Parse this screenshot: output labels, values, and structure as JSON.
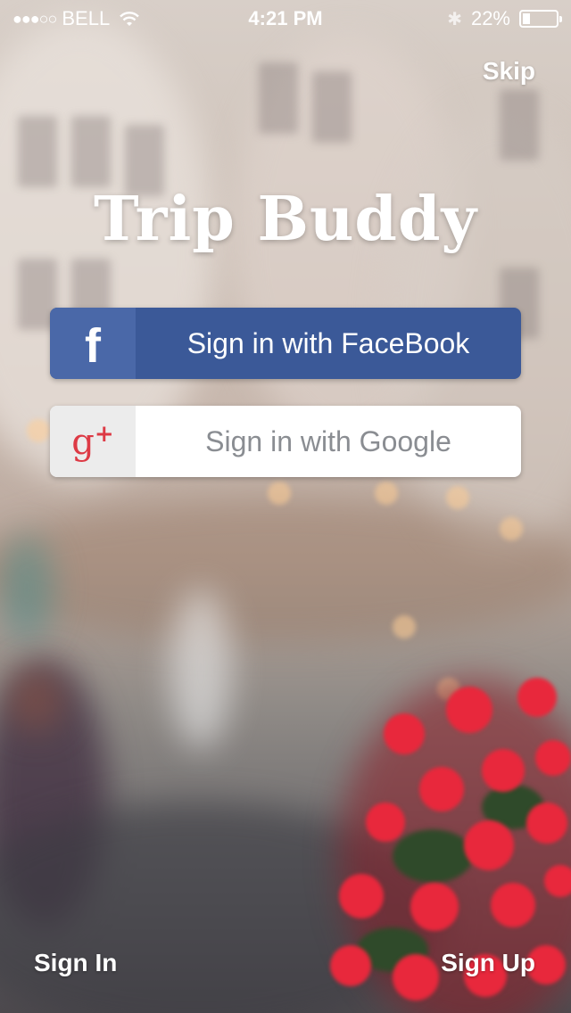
{
  "status_bar": {
    "signal": "●●●○○",
    "carrier": "BELL",
    "time": "4:21 PM",
    "bluetooth": "✱",
    "battery_percent": "22%",
    "battery_level": 0.22
  },
  "header": {
    "skip_label": "Skip"
  },
  "app": {
    "title": "Trip Buddy"
  },
  "buttons": {
    "facebook": {
      "icon_glyph": "f",
      "icon": "facebook-icon",
      "label": "Sign in with FaceBook",
      "color": "#3b5998"
    },
    "google": {
      "icon_glyph": "g",
      "icon_plus": "+",
      "icon": "google-plus-icon",
      "label": "Sign in with Google",
      "color": "#dd3a45"
    }
  },
  "footer": {
    "sign_in_label": "Sign In",
    "sign_up_label": "Sign Up"
  }
}
